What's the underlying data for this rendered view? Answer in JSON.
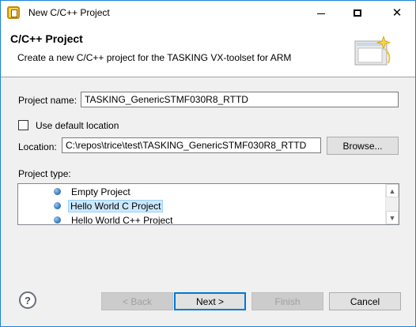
{
  "window": {
    "title": "New C/C++ Project",
    "controls": [
      "minimize",
      "maximize",
      "close"
    ]
  },
  "header": {
    "title": "C/C++ Project",
    "description": "Create a new C/C++ project for the TASKING VX-toolset for ARM"
  },
  "form": {
    "project_name_label": "Project name:",
    "project_name_value": "TASKING_GenericSTMF030R8_RTTD",
    "use_default_location_label": "Use default location",
    "use_default_location_checked": false,
    "location_label": "Location:",
    "location_value": "C:\\repos\\trice\\test\\TASKING_GenericSTMF030R8_RTTD",
    "browse_label": "Browse...",
    "project_type_label": "Project type:"
  },
  "project_types": [
    {
      "label": "Empty Project",
      "selected": false
    },
    {
      "label": "Hello World C Project",
      "selected": true
    },
    {
      "label": "Hello World C++ Project",
      "selected": false
    }
  ],
  "footer": {
    "help_glyph": "?",
    "back_label": "< Back",
    "next_label": "Next >",
    "finish_label": "Finish",
    "cancel_label": "Cancel"
  },
  "colors": {
    "accent": "#0078d7",
    "selection": "#cce8ff",
    "title_border": "#1883d7"
  }
}
